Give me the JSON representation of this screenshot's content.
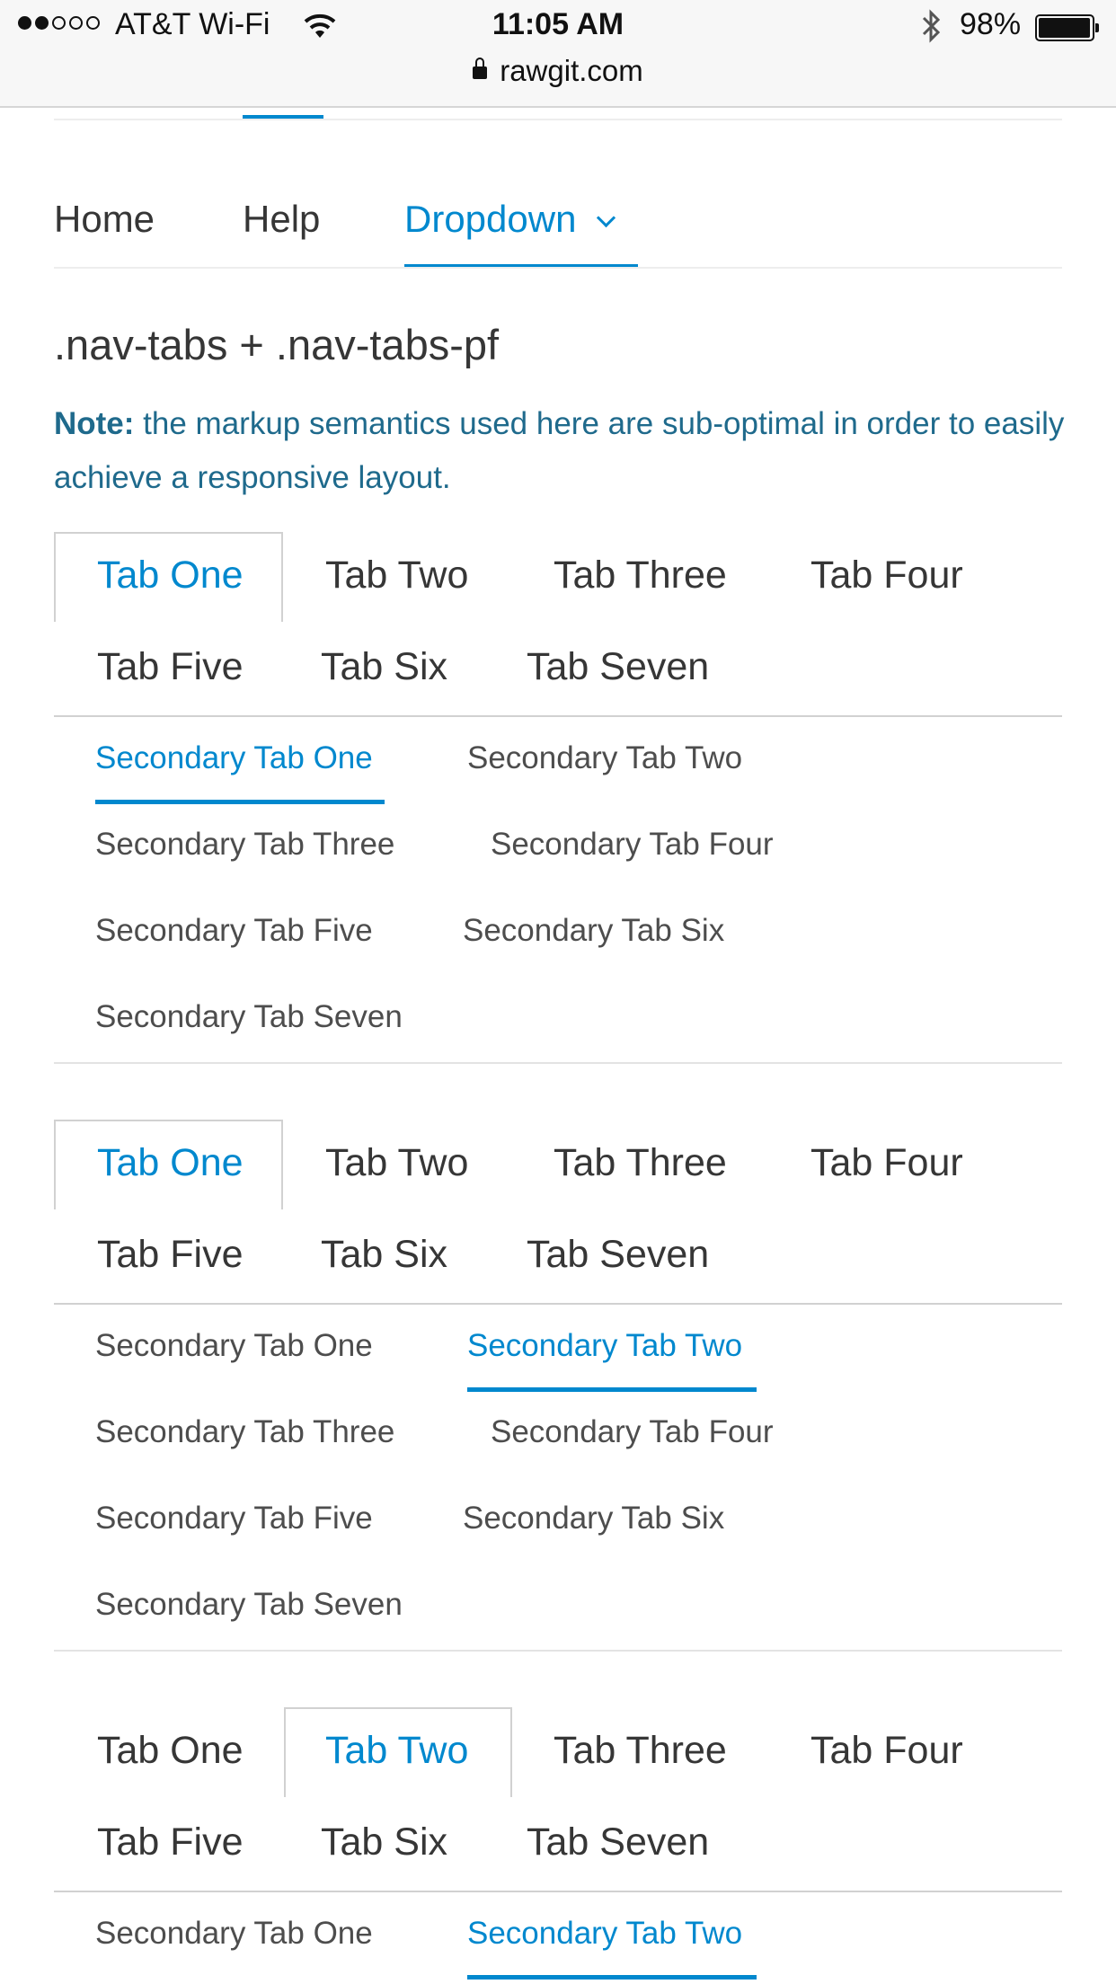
{
  "status_bar": {
    "carrier": "AT&T Wi-Fi",
    "time": "11:05 AM",
    "battery": "98%",
    "battery_level": 0.98,
    "url": "rawgit.com"
  },
  "primary_nav": {
    "items": [
      "Home",
      "Help",
      "Dropdown"
    ],
    "active": "Dropdown"
  },
  "section": {
    "heading": ".nav-tabs + .nav-tabs-pf",
    "note_label": "Note:",
    "note_text": " the markup semantics used here are sub-optimal in order to easily achieve a responsive layout."
  },
  "tab_groups": [
    {
      "tabs": [
        "Tab One",
        "Tab Two",
        "Tab Three",
        "Tab Four",
        "Tab Five",
        "Tab Six",
        "Tab Seven"
      ],
      "active_tab": "Tab One",
      "secondary_tabs": [
        "Secondary Tab One",
        "Secondary Tab Two",
        "Secondary Tab Three",
        "Secondary Tab Four",
        "Secondary Tab Five",
        "Secondary Tab Six",
        "Secondary Tab Seven"
      ],
      "active_secondary": "Secondary Tab One"
    },
    {
      "tabs": [
        "Tab One",
        "Tab Two",
        "Tab Three",
        "Tab Four",
        "Tab Five",
        "Tab Six",
        "Tab Seven"
      ],
      "active_tab": "Tab One",
      "secondary_tabs": [
        "Secondary Tab One",
        "Secondary Tab Two",
        "Secondary Tab Three",
        "Secondary Tab Four",
        "Secondary Tab Five",
        "Secondary Tab Six",
        "Secondary Tab Seven"
      ],
      "active_secondary": "Secondary Tab Two"
    },
    {
      "tabs": [
        "Tab One",
        "Tab Two",
        "Tab Three",
        "Tab Four",
        "Tab Five",
        "Tab Six",
        "Tab Seven"
      ],
      "active_tab": "Tab Two",
      "secondary_tabs": [
        "Secondary Tab One",
        "Secondary Tab Two"
      ],
      "active_secondary": "Secondary Tab Two"
    }
  ],
  "colors": {
    "accent": "#0088ce",
    "note": "#1f6a8c",
    "text": "#363636"
  }
}
